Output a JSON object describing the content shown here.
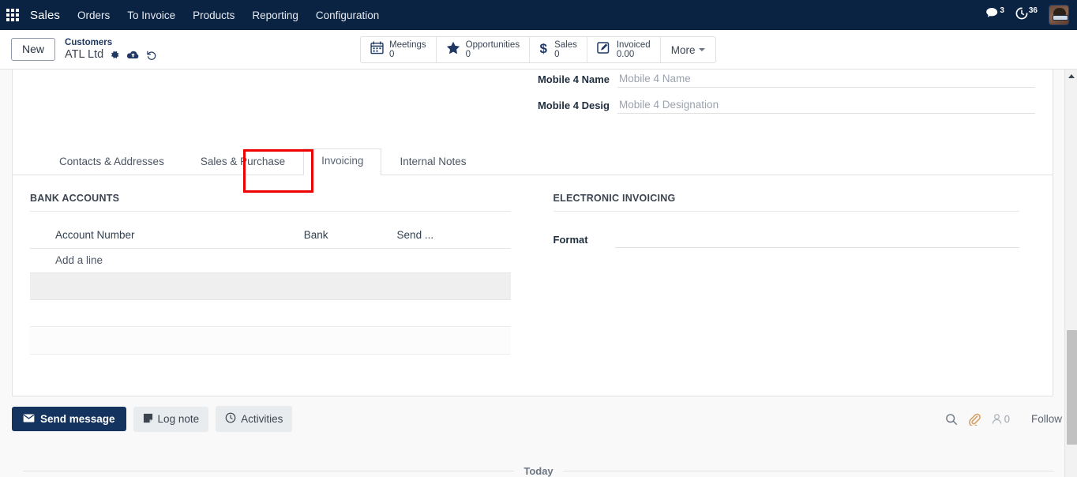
{
  "navbar": {
    "apps_icon": "apps-grid-icon",
    "brand": "Sales",
    "menu": [
      {
        "label": "Orders"
      },
      {
        "label": "To Invoice"
      },
      {
        "label": "Products"
      },
      {
        "label": "Reporting"
      },
      {
        "label": "Configuration"
      }
    ],
    "messages_count": "3",
    "activities_count": "36",
    "accent_color": "#0b2343"
  },
  "control_panel": {
    "new_button": "New",
    "breadcrumb_parent": "Customers",
    "record_name": "ATL Ltd",
    "icons": [
      "gear-icon",
      "cloud-upload-icon",
      "discard-undo-icon"
    ],
    "stat_buttons": [
      {
        "icon": "calendar-icon",
        "label": "Meetings",
        "value": "0"
      },
      {
        "icon": "star-icon",
        "label": "Opportunities",
        "value": "0"
      },
      {
        "icon": "dollar-icon",
        "label": "Sales",
        "value": "0"
      },
      {
        "icon": "pencil-square-icon",
        "label": "Invoiced",
        "value": "0.00"
      }
    ],
    "more_label": "More"
  },
  "form": {
    "fields": [
      {
        "label": "Mobile 4 Name",
        "value": "",
        "placeholder": "Mobile 4 Name"
      },
      {
        "label": "Mobile 4 Desig",
        "value": "",
        "placeholder": "Mobile 4 Designation"
      }
    ]
  },
  "notebook": {
    "tabs": [
      {
        "label": "Contacts & Addresses",
        "active": false
      },
      {
        "label": "Sales & Purchase",
        "active": false
      },
      {
        "label": "Invoicing",
        "active": true
      },
      {
        "label": "Internal Notes",
        "active": false
      }
    ],
    "highlight_color": "#ee0000"
  },
  "invoicing_tab": {
    "bank_accounts": {
      "title": "BANK ACCOUNTS",
      "columns": [
        "Account Number",
        "Bank",
        "Send ..."
      ],
      "rows": [],
      "add_line": "Add a line"
    },
    "electronic_invoicing": {
      "title": "ELECTRONIC INVOICING",
      "format_label": "Format",
      "format_value": ""
    }
  },
  "chatter": {
    "send_message": "Send message",
    "log_note": "Log note",
    "activities": "Activities",
    "search_icon": "search-icon",
    "attachment_icon": "paperclip-icon",
    "followers_icon": "user-icon",
    "followers_count": "0",
    "follow_label": "Follow",
    "day_separator": "Today"
  }
}
